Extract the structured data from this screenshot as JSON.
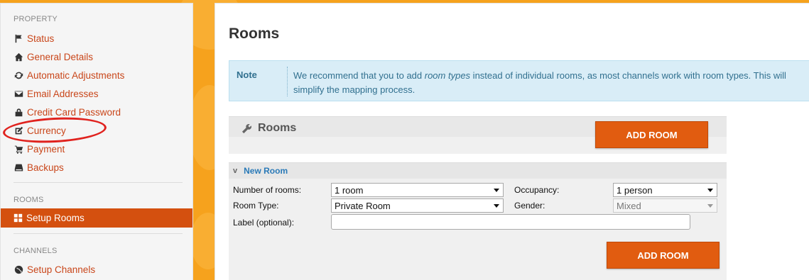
{
  "sidebar": {
    "property_title": "PROPERTY",
    "property_items": [
      {
        "label": "Status",
        "icon": "flag-icon"
      },
      {
        "label": "General Details",
        "icon": "home-icon"
      },
      {
        "label": "Automatic Adjustments",
        "icon": "refresh-icon"
      },
      {
        "label": "Email Addresses",
        "icon": "envelope-icon"
      },
      {
        "label": "Credit Card Password",
        "icon": "lock-icon"
      },
      {
        "label": "Currency",
        "icon": "edit-icon"
      },
      {
        "label": "Payment",
        "icon": "cart-icon"
      },
      {
        "label": "Backups",
        "icon": "drive-icon"
      }
    ],
    "rooms_title": "ROOMS",
    "rooms_active": {
      "label": "Setup Rooms",
      "icon": "grid-icon"
    },
    "channels_title": "CHANNELS",
    "channels_items": [
      {
        "label": "Setup Channels",
        "icon": "globe-icon"
      }
    ]
  },
  "main": {
    "title": "Rooms",
    "note": {
      "label": "Note",
      "text_before": "We recommend that you to add ",
      "text_em": "room types",
      "text_after": " instead of individual rooms, as most channels work with room types. This will simplify the mapping process."
    },
    "rooms_panel": {
      "title": "Rooms",
      "add_button": "ADD ROOM"
    },
    "new_room": {
      "title": "New Room",
      "chevron": "v",
      "number_label": "Number of rooms:",
      "number_value": "1 room",
      "occupancy_label": "Occupancy:",
      "occupancy_value": "1 person",
      "type_label": "Room Type:",
      "type_value": "Private Room",
      "gender_label": "Gender:",
      "gender_value": "Mixed",
      "label_label": "Label (optional):",
      "label_value": "",
      "add_button": "ADD ROOM"
    }
  },
  "colors": {
    "accent": "#d4500f",
    "link": "#c9461a",
    "note_bg": "#d9edf7",
    "annotation": "#e0221e"
  }
}
